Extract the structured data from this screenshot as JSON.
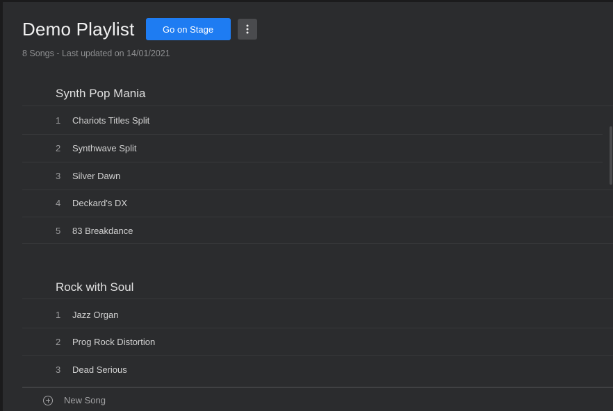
{
  "playlist": {
    "title": "Demo Playlist",
    "stage_button": "Go on Stage",
    "more_icon": "vertical-dots-icon",
    "subtitle": "8 Songs - Last updated on 14/01/2021"
  },
  "groups": [
    {
      "title": "Synth Pop Mania",
      "songs": [
        {
          "num": "1",
          "name": "Chariots Titles Split"
        },
        {
          "num": "2",
          "name": "Synthwave Split"
        },
        {
          "num": "3",
          "name": "Silver Dawn"
        },
        {
          "num": "4",
          "name": "Deckard's DX"
        },
        {
          "num": "5",
          "name": "83 Breakdance"
        }
      ]
    },
    {
      "title": "Rock with Soul",
      "songs": [
        {
          "num": "1",
          "name": "Jazz Organ"
        },
        {
          "num": "2",
          "name": "Prog Rock Distortion"
        },
        {
          "num": "3",
          "name": "Dead Serious"
        }
      ]
    }
  ],
  "footer": {
    "new_song": "New Song",
    "new_song_icon": "plus-circle-icon"
  },
  "colors": {
    "background": "#2b2c2e",
    "accent": "#1e7cf2"
  }
}
